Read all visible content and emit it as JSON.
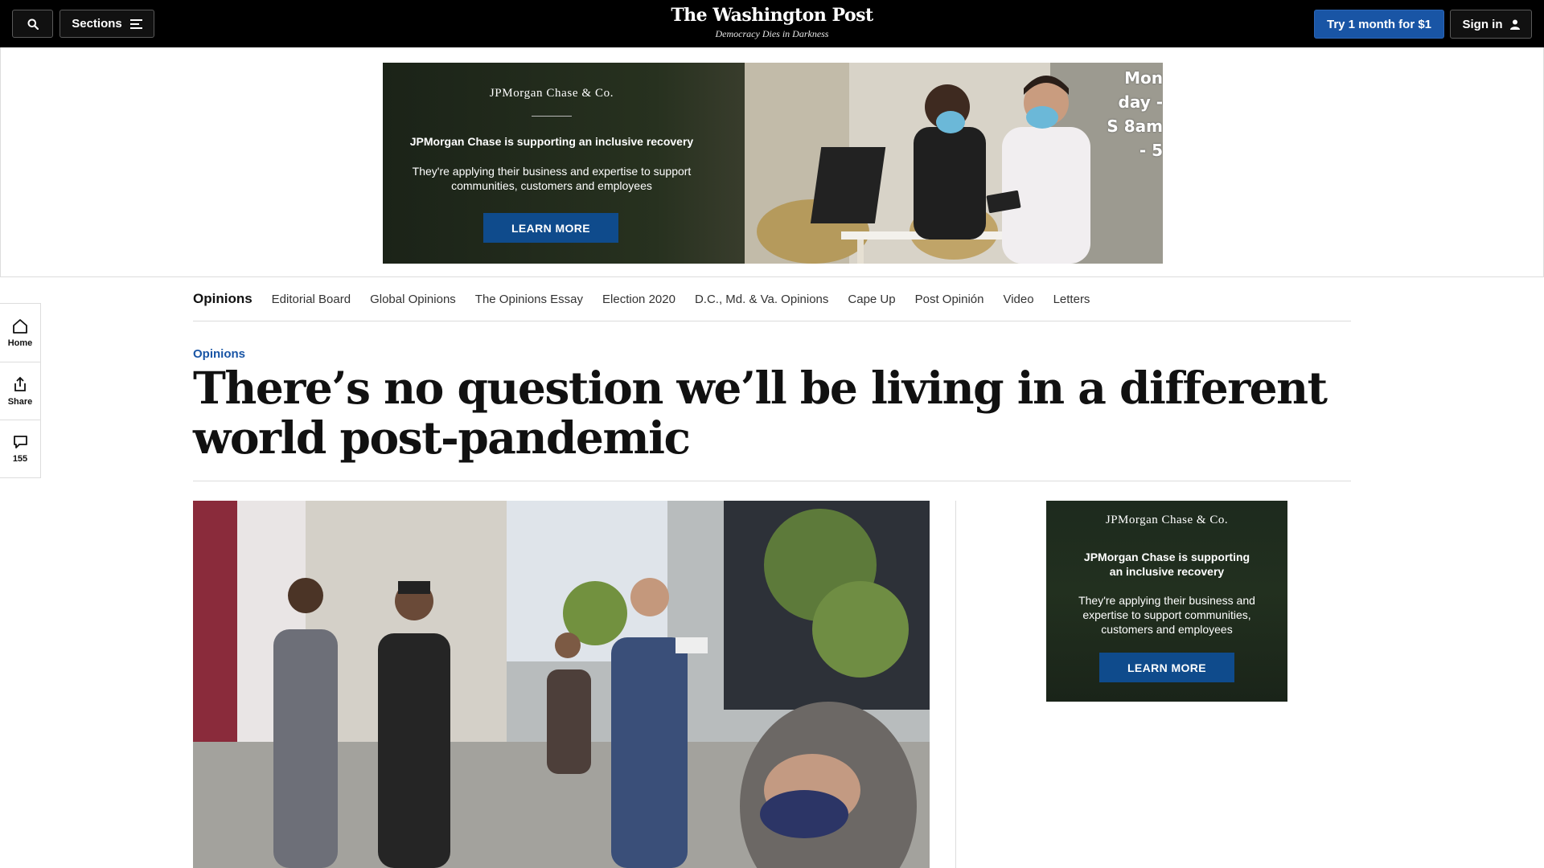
{
  "header": {
    "sections_label": "Sections",
    "logo_name": "The Washington Post",
    "tagline": "Democracy Dies in Darkness",
    "try_label": "Try 1 month for $1",
    "signin_label": "Sign in"
  },
  "banner_ad": {
    "brand": "JPMorgan Chase & Co.",
    "headline": "JPMorgan Chase is supporting an inclusive recovery",
    "body": "They're applying their business and expertise to support communities, customers and employees",
    "cta": "LEARN MORE",
    "photo_sign": "Mon day - S 8am - 5"
  },
  "section_nav": {
    "items": [
      "Opinions",
      "Editorial Board",
      "Global Opinions",
      "The Opinions Essay",
      "Election 2020",
      "D.C., Md. & Va. Opinions",
      "Cape Up",
      "Post Opinión",
      "Video",
      "Letters"
    ]
  },
  "left_rail": {
    "home": "Home",
    "share": "Share",
    "comments": "155"
  },
  "article": {
    "kicker": "Opinions",
    "headline": "There’s no question we’ll be living in a different world post-pandemic"
  },
  "side_ad": {
    "brand": "JPMorgan Chase & Co.",
    "headline": "JPMorgan Chase is supporting an inclusive recovery",
    "body": "They're applying their business and expertise to support communities, customers and employees",
    "cta": "LEARN MORE"
  },
  "colors": {
    "topbar": "#000000",
    "accent_blue": "#1955a5",
    "ad_button": "#0f4b8c"
  }
}
